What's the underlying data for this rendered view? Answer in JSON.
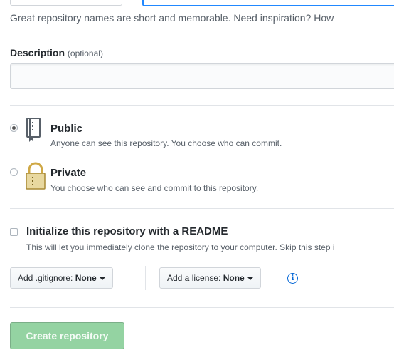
{
  "name_hint": "Great repository names are short and memorable. Need inspiration? How",
  "description": {
    "label": "Description",
    "optional": "(optional)",
    "value": ""
  },
  "visibility": {
    "selected": "public",
    "public": {
      "title": "Public",
      "note": "Anyone can see this repository. You choose who can commit.",
      "icon": "repo-icon"
    },
    "private": {
      "title": "Private",
      "note": "You choose who can see and commit to this repository.",
      "icon": "lock-icon"
    }
  },
  "readme": {
    "checked": false,
    "title": "Initialize this repository with a README",
    "note": "This will let you immediately clone the repository to your computer. Skip this step i"
  },
  "gitignore": {
    "label": "Add .gitignore:",
    "value": "None"
  },
  "license": {
    "label": "Add a license:",
    "value": "None"
  },
  "create_button": "Create repository",
  "colors": {
    "primary_disabled": "#94d3a2",
    "focus_border": "#2188ff",
    "info": "#0366d6",
    "private_icon": "#cfa845"
  }
}
